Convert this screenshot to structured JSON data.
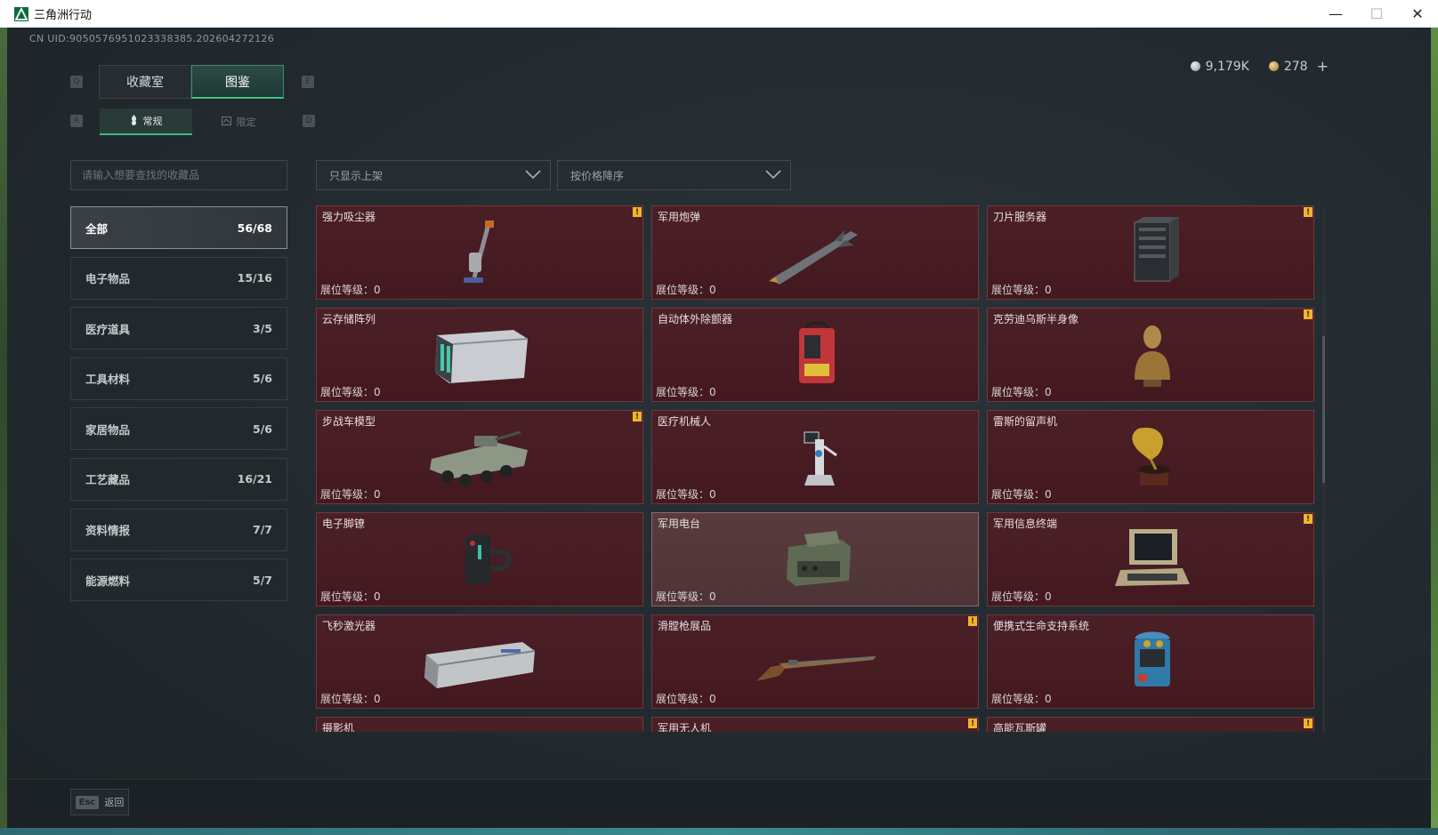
{
  "window": {
    "title": "三角洲行动",
    "minimize": "—",
    "maximize": "☐",
    "close": "✕"
  },
  "uid": "CN UID:9050576951023338385.202604272126",
  "currency": {
    "silver": "9,179K",
    "gold": "278",
    "add": "+"
  },
  "keys": {
    "q": "Q",
    "e": "E",
    "a": "A",
    "d": "D",
    "esc": "Esc"
  },
  "tabs": [
    {
      "label": "收藏室"
    },
    {
      "label": "图鉴"
    }
  ],
  "subtabs": [
    {
      "label": "常规"
    },
    {
      "label": "限定"
    }
  ],
  "search": {
    "placeholder": "请输入想要查找的收藏品"
  },
  "filters": {
    "shelf": "只显示上架",
    "sort": "按价格降序"
  },
  "categories": [
    {
      "label": "全部",
      "count": "56/68"
    },
    {
      "label": "电子物品",
      "count": "15/16"
    },
    {
      "label": "医疗道具",
      "count": "3/5"
    },
    {
      "label": "工具材料",
      "count": "5/6"
    },
    {
      "label": "家居物品",
      "count": "5/6"
    },
    {
      "label": "工艺藏品",
      "count": "16/21"
    },
    {
      "label": "资料情报",
      "count": "7/7"
    },
    {
      "label": "能源燃料",
      "count": "5/7"
    }
  ],
  "badge_mark": "!",
  "items": [
    {
      "name": "强力吸尘器",
      "level": "展位等级：0",
      "icon": "vacuum-icon"
    },
    {
      "name": "军用炮弹",
      "level": "展位等级：0",
      "icon": "missile-icon"
    },
    {
      "name": "刀片服务器",
      "level": "展位等级：0",
      "icon": "server-icon"
    },
    {
      "name": "云存储阵列",
      "level": "展位等级：0",
      "icon": "storage-array-icon"
    },
    {
      "name": "自动体外除颤器",
      "level": "展位等级：0",
      "icon": "defibrillator-icon"
    },
    {
      "name": "克劳迪乌斯半身像",
      "level": "展位等级：0",
      "icon": "bust-icon"
    },
    {
      "name": "步战车模型",
      "level": "展位等级：0",
      "icon": "ifv-model-icon"
    },
    {
      "name": "医疗机械人",
      "level": "展位等级：0",
      "icon": "medical-robot-icon"
    },
    {
      "name": "雷斯的留声机",
      "level": "展位等级：0",
      "icon": "gramophone-icon"
    },
    {
      "name": "电子脚镣",
      "level": "展位等级：0",
      "icon": "ankle-monitor-icon"
    },
    {
      "name": "军用电台",
      "level": "展位等级：0",
      "icon": "radio-icon"
    },
    {
      "name": "军用信息终端",
      "level": "展位等级：0",
      "icon": "terminal-icon"
    },
    {
      "name": "飞秒激光器",
      "level": "展位等级：0",
      "icon": "laser-icon"
    },
    {
      "name": "滑膛枪展品",
      "level": "展位等级：0",
      "icon": "musket-icon"
    },
    {
      "name": "便携式生命支持系统",
      "level": "展位等级：0",
      "icon": "life-support-icon"
    },
    {
      "name": "摄影机",
      "level": "",
      "icon": "camera-icon"
    },
    {
      "name": "军用无人机",
      "level": "",
      "icon": "drone-icon"
    },
    {
      "name": "高能瓦斯罐",
      "level": "",
      "icon": "gas-tank-icon"
    }
  ],
  "footer": {
    "back": "返回"
  }
}
